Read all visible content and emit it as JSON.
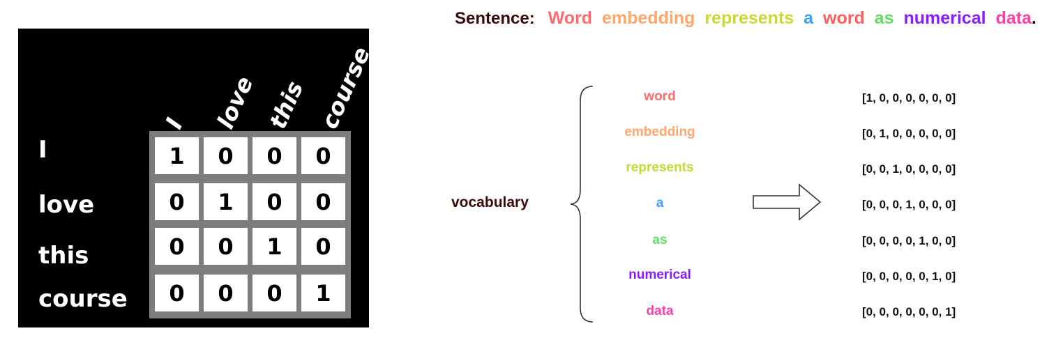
{
  "matrix": {
    "column_headers": [
      "I",
      "love",
      "this",
      "course"
    ],
    "row_labels": [
      "I",
      "love",
      "this",
      "course"
    ],
    "cells": [
      [
        "1",
        "0",
        "0",
        "0"
      ],
      [
        "0",
        "1",
        "0",
        "0"
      ],
      [
        "0",
        "0",
        "1",
        "0"
      ],
      [
        "0",
        "0",
        "0",
        "1"
      ]
    ]
  },
  "sentence": {
    "label": "Sentence:",
    "words": [
      {
        "text": "Word",
        "color": "#ff6b6b"
      },
      {
        "text": "embedding",
        "color": "#ffa66b"
      },
      {
        "text": "represents",
        "color": "#c8d930"
      },
      {
        "text": "a",
        "color": "#3aa0ff"
      },
      {
        "text": "word",
        "color": "#ff5e5e"
      },
      {
        "text": "as",
        "color": "#5fe05f"
      },
      {
        "text": "numerical",
        "color": "#8a1cff"
      },
      {
        "text": "data",
        "color": "#ff3fa6"
      }
    ],
    "period": "."
  },
  "vocabulary": {
    "label": "vocabulary",
    "words": [
      {
        "text": "word",
        "color": "#ff6b6b"
      },
      {
        "text": "embedding",
        "color": "#ffa66b"
      },
      {
        "text": "represents",
        "color": "#c8d930"
      },
      {
        "text": "a",
        "color": "#3aa0ff"
      },
      {
        "text": "as",
        "color": "#5fe05f"
      },
      {
        "text": "numerical",
        "color": "#8a1cff"
      },
      {
        "text": "data",
        "color": "#ff3fa6"
      }
    ],
    "vectors": [
      "[1, 0, 0, 0, 0, 0, 0]",
      "[0, 1, 0, 0, 0, 0, 0]",
      "[0, 0, 1, 0, 0, 0, 0]",
      "[0, 0, 0, 1, 0, 0, 0]",
      "[0, 0, 0, 0, 1, 0, 0]",
      "[0, 0, 0, 0, 0, 1, 0]",
      "[0, 0, 0, 0, 0, 0, 1]"
    ]
  },
  "icons": {
    "brace": "left-curly-brace-icon",
    "arrow": "right-arrow-icon"
  }
}
